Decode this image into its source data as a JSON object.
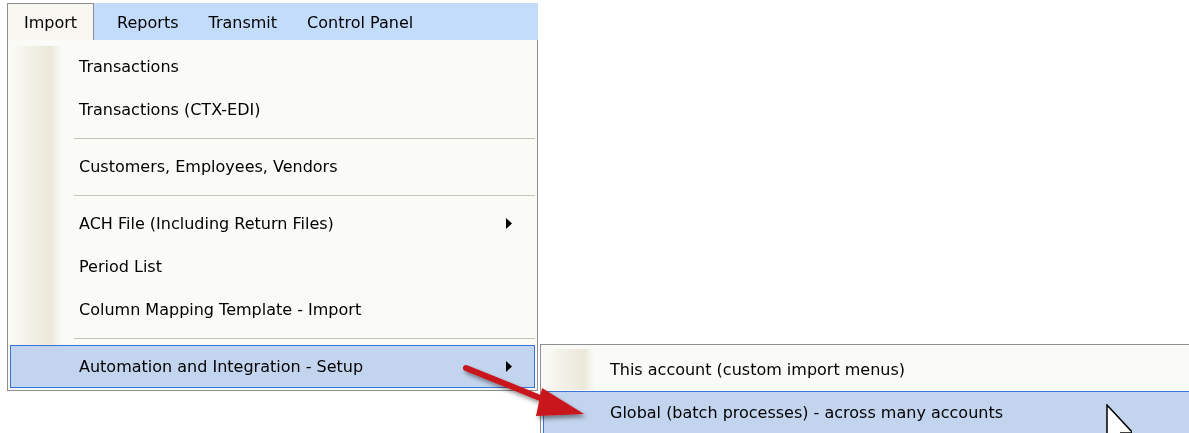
{
  "menubar": {
    "tabs": [
      {
        "label": "Import",
        "selected": true
      },
      {
        "label": "Reports",
        "selected": false
      },
      {
        "label": "Transmit",
        "selected": false
      },
      {
        "label": "Control Panel",
        "selected": false
      }
    ]
  },
  "menu": {
    "items": [
      {
        "kind": "item",
        "label": "Transactions",
        "submenu": false,
        "selected": false
      },
      {
        "kind": "item",
        "label": "Transactions (CTX-EDI)",
        "submenu": false,
        "selected": false
      },
      {
        "kind": "separator"
      },
      {
        "kind": "item",
        "label": "Customers, Employees, Vendors",
        "submenu": false,
        "selected": false
      },
      {
        "kind": "separator"
      },
      {
        "kind": "item",
        "label": "ACH File (Including Return Files)",
        "submenu": true,
        "selected": false
      },
      {
        "kind": "item",
        "label": "Period List",
        "submenu": false,
        "selected": false
      },
      {
        "kind": "item",
        "label": "Column Mapping Template - Import",
        "submenu": false,
        "selected": false
      },
      {
        "kind": "separator"
      },
      {
        "kind": "item",
        "label": "Automation and Integration - Setup",
        "submenu": true,
        "selected": true
      }
    ]
  },
  "submenu": {
    "items": [
      {
        "kind": "item",
        "label": "This account (custom import menus)",
        "selected": false
      },
      {
        "kind": "item",
        "label": "Global (batch processes) - across many accounts",
        "selected": true
      }
    ]
  }
}
